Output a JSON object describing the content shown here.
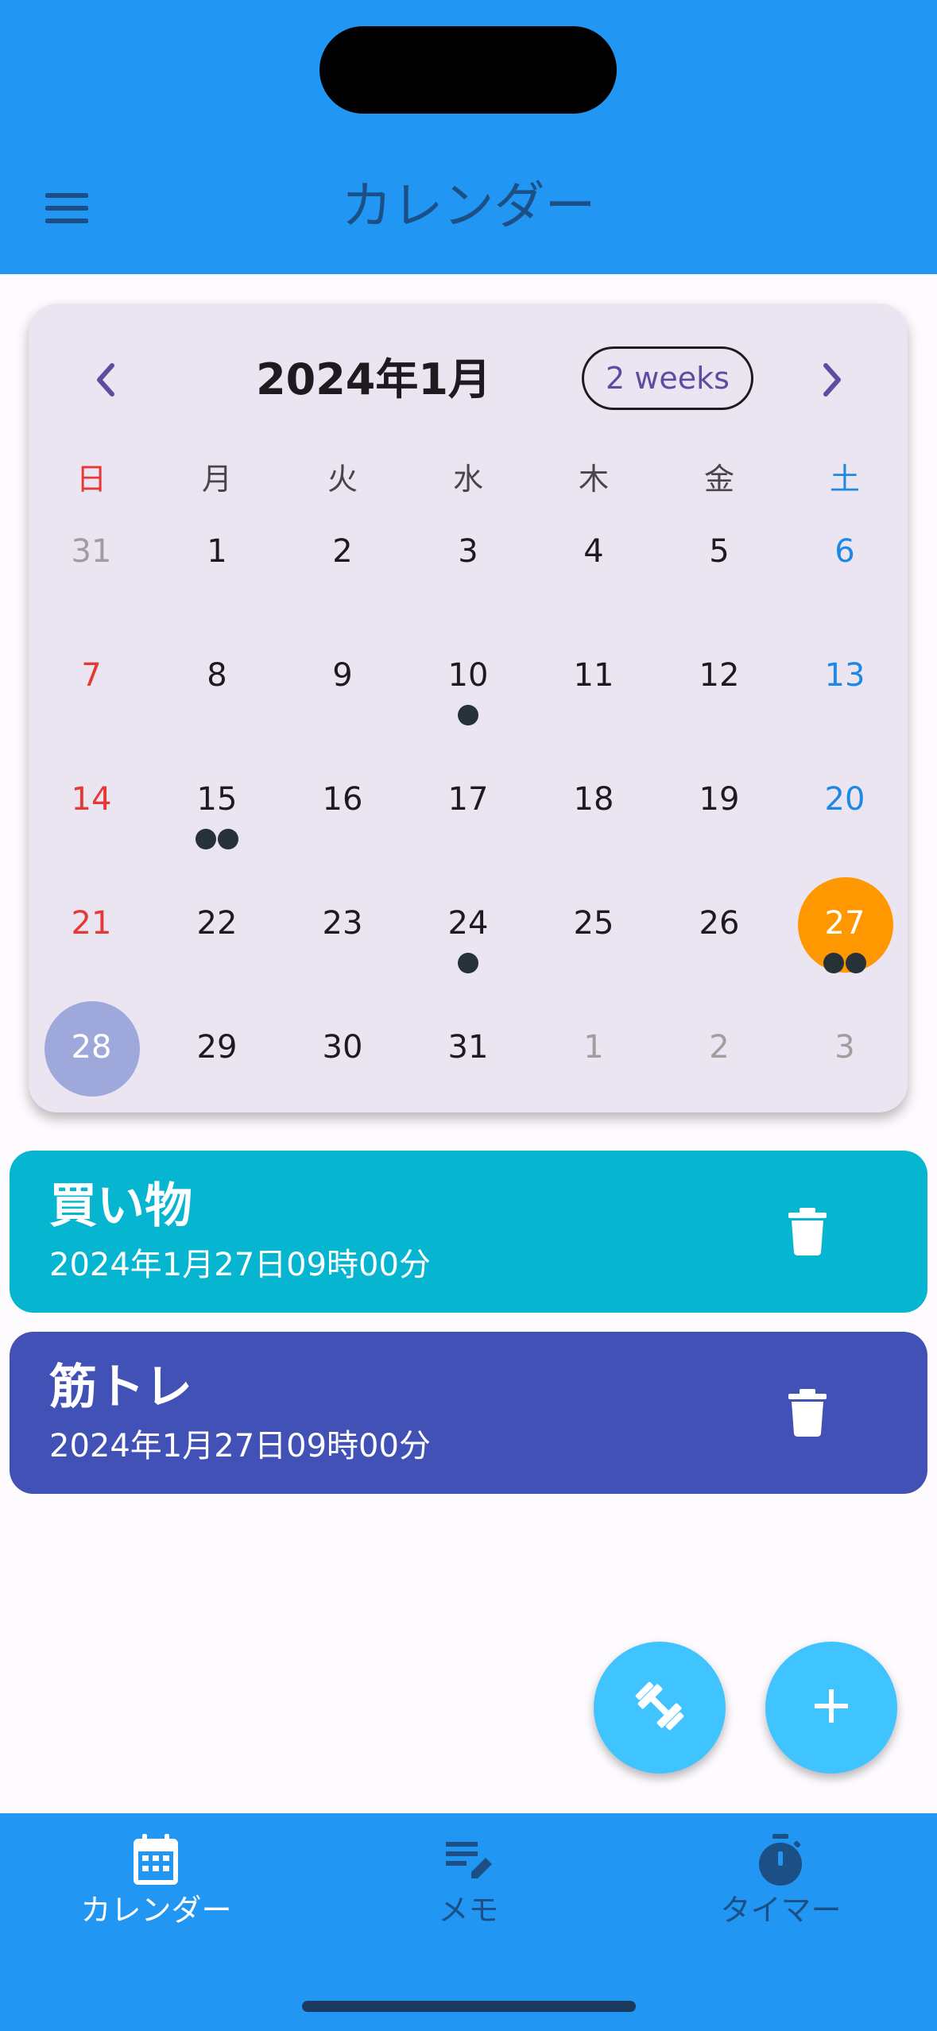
{
  "app_bar": {
    "title": "カレンダー"
  },
  "calendar": {
    "month_title": "2024年1月",
    "format_button": "2 weeks",
    "weekdays": [
      "日",
      "月",
      "火",
      "水",
      "木",
      "金",
      "土"
    ],
    "weeks": [
      [
        {
          "d": "31",
          "m": "out"
        },
        {
          "d": "1"
        },
        {
          "d": "2"
        },
        {
          "d": "3"
        },
        {
          "d": "4"
        },
        {
          "d": "5"
        },
        {
          "d": "6"
        }
      ],
      [
        {
          "d": "7"
        },
        {
          "d": "8"
        },
        {
          "d": "9"
        },
        {
          "d": "10",
          "dots": 1
        },
        {
          "d": "11"
        },
        {
          "d": "12"
        },
        {
          "d": "13"
        }
      ],
      [
        {
          "d": "14"
        },
        {
          "d": "15",
          "dots": 2
        },
        {
          "d": "16"
        },
        {
          "d": "17"
        },
        {
          "d": "18"
        },
        {
          "d": "19"
        },
        {
          "d": "20"
        }
      ],
      [
        {
          "d": "21"
        },
        {
          "d": "22"
        },
        {
          "d": "23"
        },
        {
          "d": "24",
          "dots": 1
        },
        {
          "d": "25"
        },
        {
          "d": "26"
        },
        {
          "d": "27",
          "dots": 2,
          "state": "selected"
        }
      ],
      [
        {
          "d": "28",
          "state": "today"
        },
        {
          "d": "29"
        },
        {
          "d": "30"
        },
        {
          "d": "31"
        },
        {
          "d": "1",
          "m": "out"
        },
        {
          "d": "2",
          "m": "out"
        },
        {
          "d": "3",
          "m": "out"
        }
      ]
    ],
    "colors": {
      "sunday": "#e53935",
      "saturday": "#1e88e5",
      "outside": "#9e9e9e",
      "weekday": "#1d1b20",
      "selected": "#ff9800",
      "today": "#9fa8da"
    }
  },
  "events": [
    {
      "title": "買い物",
      "datetime": "2024年1月27日09時00分",
      "color": "#06b6d0"
    },
    {
      "title": "筋トレ",
      "datetime": "2024年1月27日09時00分",
      "color": "#4151b5"
    }
  ],
  "fabs": {
    "workout_icon": "dumbbell-icon",
    "add_icon": "plus-icon"
  },
  "bottom_nav": {
    "items": [
      {
        "label": "カレンダー",
        "icon": "calendar-icon",
        "active": true
      },
      {
        "label": "メモ",
        "icon": "memo-edit-icon",
        "active": false
      },
      {
        "label": "タイマー",
        "icon": "timer-icon",
        "active": false
      }
    ],
    "active_color": "#ffffff",
    "inactive_color": "#1c4f86"
  }
}
